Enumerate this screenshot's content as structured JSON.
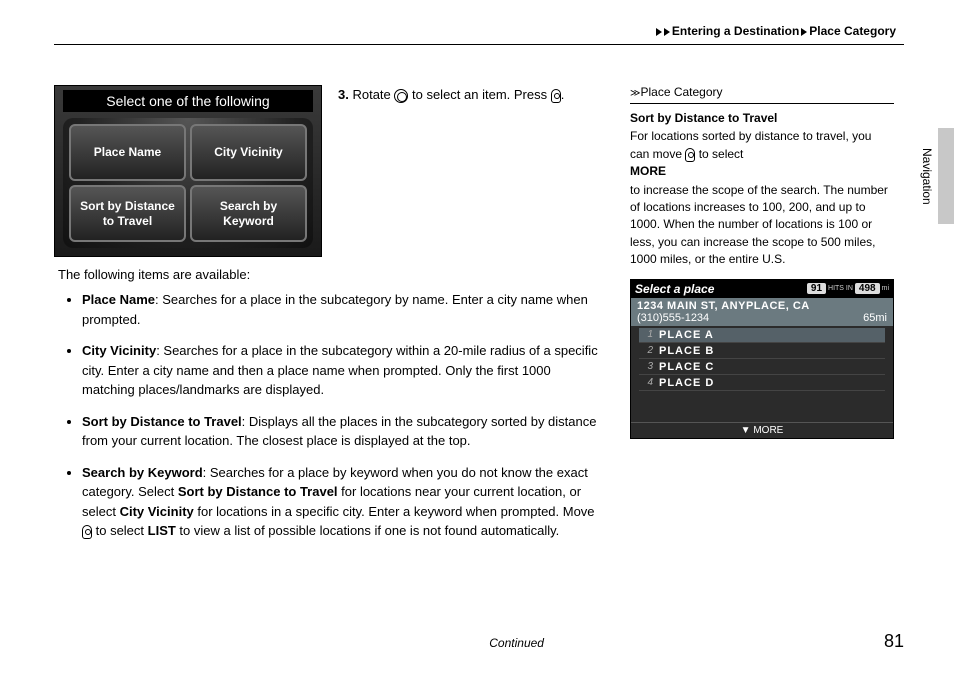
{
  "breadcrumb": {
    "a": "Entering a Destination",
    "b": "Place Category"
  },
  "screen1": {
    "title": "Select one of the following",
    "btns": [
      "Place Name",
      "City Vicinity",
      "Sort by Distance to Travel",
      "Search by Keyword"
    ]
  },
  "step": {
    "num": "3.",
    "text_a": "Rotate ",
    "text_b": " to select an item. Press ",
    "text_c": "."
  },
  "intro": "The following items are available:",
  "bullets": [
    {
      "term": "Place Name",
      "text": ": Searches for a place in the subcategory by name. Enter a city name when prompted."
    },
    {
      "term": "City Vicinity",
      "text": ": Searches for a place in the subcategory within a 20-mile radius of a specific city. Enter a city name and then a place name when prompted. Only the first 1000 matching places/landmarks are displayed."
    },
    {
      "term": "Sort by Distance to Travel",
      "text": ": Displays all the places in the subcategory sorted by distance from your current location. The closest place is displayed at the top."
    }
  ],
  "bullet4": {
    "term": "Search by Keyword",
    "t1": ": Searches for a place by keyword when you do not know the exact category. Select ",
    "b1": "Sort by Distance to Travel",
    "t2": " for locations near your current location, or select ",
    "b2": "City Vicinity",
    "t3": " for locations in a specific city. Enter a keyword when prompted. Move ",
    "t4": " to select ",
    "b3": "LIST",
    "t5": " to view a list of possible locations if one is not found automatically."
  },
  "rcrumb": "Place Category",
  "info": {
    "title": "Sort by Distance to Travel",
    "t1": "For locations sorted by distance to travel, you can move ",
    "t2": " to select ",
    "b1": "MORE",
    "t3": " to increase the scope of the search. The number of locations increases to 100, 200, and up to 1000. When the number of locations is 100 or less, you can increase the scope to 500 miles, 1000 miles, or the entire U.S."
  },
  "screen2": {
    "title": "Select a place",
    "hits": "91",
    "hits_label": "HITS IN",
    "radius": "498",
    "radius_unit": "mi",
    "addr": "1234 MAIN ST, ANYPLACE, CA",
    "phone": "(310)555-1234",
    "dist": "65mi",
    "rows": [
      {
        "n": "1",
        "label": "PLACE A"
      },
      {
        "n": "2",
        "label": "PLACE B"
      },
      {
        "n": "3",
        "label": "PLACE C"
      },
      {
        "n": "4",
        "label": "PLACE D"
      }
    ],
    "more": "MORE"
  },
  "side": "Navigation",
  "continued": "Continued",
  "page": "81"
}
